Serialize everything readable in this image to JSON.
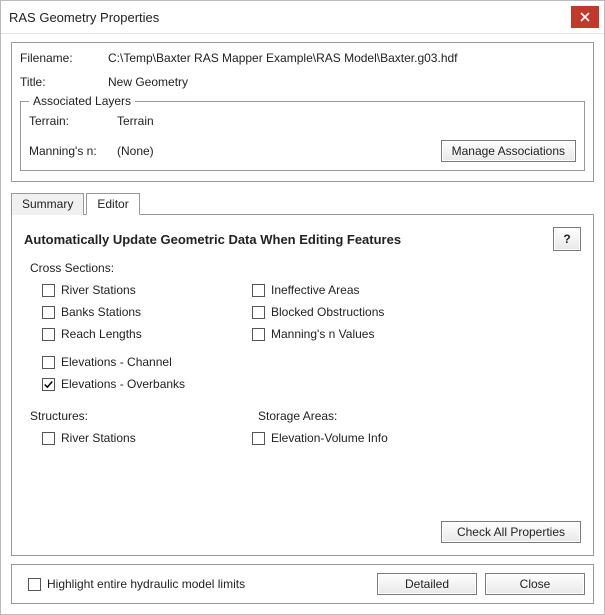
{
  "window": {
    "title": "RAS Geometry Properties",
    "close_label": "×"
  },
  "info": {
    "filename_label": "Filename:",
    "filename_value": "C:\\Temp\\Baxter RAS Mapper Example\\RAS Model\\Baxter.g03.hdf",
    "title_label": "Title:",
    "title_value": "New Geometry"
  },
  "assoc": {
    "legend": "Associated Layers",
    "terrain_label": "Terrain:",
    "terrain_value": "Terrain",
    "mannings_label": "Manning's n:",
    "mannings_value": "(None)",
    "manage_btn": "Manage Associations"
  },
  "tabs": {
    "summary": "Summary",
    "editor": "Editor",
    "active": "editor"
  },
  "editor": {
    "heading": "Automatically Update Geometric Data When Editing Features",
    "help": "?",
    "cross_sections_label": "Cross Sections:",
    "cs_left": [
      {
        "key": "river_stations",
        "label": "River Stations",
        "checked": false
      },
      {
        "key": "banks_stations",
        "label": "Banks Stations",
        "checked": false
      },
      {
        "key": "reach_lengths",
        "label": "Reach Lengths",
        "checked": false
      }
    ],
    "cs_right": [
      {
        "key": "ineffective_areas",
        "label": "Ineffective Areas",
        "checked": false
      },
      {
        "key": "blocked_obstructions",
        "label": "Blocked Obstructions",
        "checked": false
      },
      {
        "key": "mannings_n_values",
        "label": "Manning's n Values",
        "checked": false
      }
    ],
    "cs_extra": [
      {
        "key": "elevations_channel",
        "label": "Elevations - Channel",
        "checked": false
      },
      {
        "key": "elevations_overbanks",
        "label": "Elevations - Overbanks",
        "checked": true
      }
    ],
    "structures_label": "Structures:",
    "structures": [
      {
        "key": "struct_river_stations",
        "label": "River Stations",
        "checked": false
      }
    ],
    "storage_label": "Storage Areas:",
    "storage": [
      {
        "key": "elevation_volume_info",
        "label": "Elevation-Volume Info",
        "checked": false
      }
    ],
    "check_all_btn": "Check All Properties"
  },
  "footer": {
    "highlight_label": "Highlight entire hydraulic model limits",
    "highlight_checked": false,
    "detailed_btn": "Detailed",
    "close_btn": "Close"
  }
}
